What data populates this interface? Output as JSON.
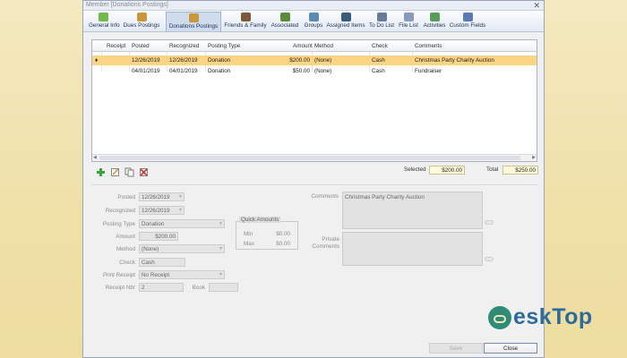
{
  "window": {
    "title": "Member [Donations Postings]"
  },
  "ribbon": {
    "tabs": [
      {
        "label": "General Info",
        "icon": "general-info-icon",
        "color": "#6fb84a"
      },
      {
        "label": "Dues Postings",
        "icon": "dues-postings-icon",
        "color": "#c9963a"
      },
      {
        "label": "Donations Postings",
        "icon": "donations-postings-icon",
        "color": "#c9963a"
      },
      {
        "label": "Friends & Family",
        "icon": "friends-family-icon",
        "color": "#7a5a3a"
      },
      {
        "label": "Associated",
        "icon": "associated-icon",
        "color": "#5a8a3a"
      },
      {
        "label": "Groups",
        "icon": "groups-icon",
        "color": "#5a8ab0"
      },
      {
        "label": "Assigned Items",
        "icon": "assigned-items-icon",
        "color": "#3a5a7a"
      },
      {
        "label": "To Do List",
        "icon": "todo-list-icon",
        "color": "#6a7a9a"
      },
      {
        "label": "File List",
        "icon": "file-list-icon",
        "color": "#8a9aba"
      },
      {
        "label": "Activities",
        "icon": "activities-icon",
        "color": "#5a9a5a"
      },
      {
        "label": "Custom Fields",
        "icon": "custom-fields-icon",
        "color": "#5a7ab0"
      }
    ]
  },
  "grid": {
    "columns": [
      "Receipt",
      "Posted",
      "Recognized",
      "Posting Type",
      "Amount",
      "Method",
      "Check",
      "Comments"
    ],
    "rows": [
      {
        "marker": "♦",
        "receipt": "",
        "posted": "12/26/2019",
        "recognized": "12/26/2019",
        "type": "Donation",
        "amount": "$200.00",
        "method": "(None)",
        "check": "Cash",
        "comments": "Christmas Party Charity Auction"
      },
      {
        "marker": "",
        "receipt": "",
        "posted": "04/01/2019",
        "recognized": "04/01/2019",
        "type": "Donation",
        "amount": "$50.00",
        "method": "(None)",
        "check": "Cash",
        "comments": "Fundraiser"
      }
    ]
  },
  "summary": {
    "selected_label": "Selected",
    "selected_value": "$200.00",
    "total_label": "Total",
    "total_value": "$250.00"
  },
  "form": {
    "posted_label": "Posted",
    "posted_value": "12/26/2019",
    "recognized_label": "Recognized",
    "recognized_value": "12/26/2019",
    "posting_type_label": "Posting Type",
    "posting_type_value": "Donation",
    "amount_label": "Amount",
    "amount_value": "$200.00",
    "method_label": "Method",
    "method_value": "(None)",
    "check_label": "Check",
    "check_value": "Cash",
    "print_receipt_label": "Print Receipt",
    "print_receipt_value": "No Receipt",
    "receipt_nbr_label": "Receipt Nbr",
    "receipt_nbr_value": "2",
    "book_label": "Book",
    "book_value": "",
    "quick_amounts_label": "Quick Amounts",
    "min_label": "Min",
    "min_value": "$0.00",
    "max_label": "Max",
    "max_value": "$0.00",
    "comments_label": "Comments",
    "comments_value": "Christmas Party Charity Auction",
    "private_comments_label": "Private Comments",
    "private_comments_value": ""
  },
  "buttons": {
    "save_label": "Save",
    "close_label": "Close"
  },
  "watermark": {
    "text": "eskTop"
  }
}
